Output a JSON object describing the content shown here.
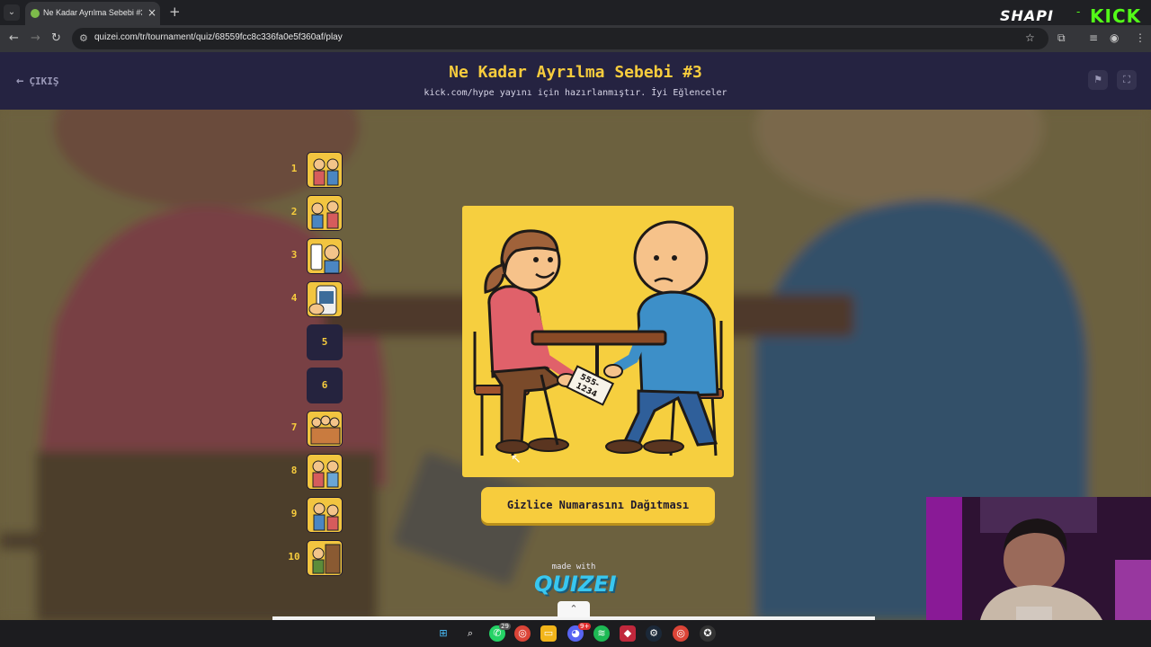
{
  "browser": {
    "tab_title": "Ne Kadar Ayrılma Sebebi #3 - T",
    "url": "quizei.com/tr/tournament/quiz/68559fcc8c336fa0e5f360af/play",
    "brand_left": "SHAPI",
    "brand_right": "KICK"
  },
  "header": {
    "exit_label": "ÇIKIŞ",
    "title": "Ne Kadar Ayrılma Sebebi #3",
    "subtitle": "kick.com/hype yayını için hazırlanmıştır. İyi Eğlenceler"
  },
  "progress": [
    {
      "num": "1",
      "state": "image"
    },
    {
      "num": "2",
      "state": "image"
    },
    {
      "num": "3",
      "state": "image"
    },
    {
      "num": "4",
      "state": "image"
    },
    {
      "num": "5",
      "state": "empty"
    },
    {
      "num": "6",
      "state": "empty"
    },
    {
      "num": "7",
      "state": "image"
    },
    {
      "num": "8",
      "state": "image"
    },
    {
      "num": "9",
      "state": "image"
    },
    {
      "num": "10",
      "state": "image"
    }
  ],
  "card": {
    "note_text_1": "555-",
    "note_text_2": "1234",
    "answer_label": "Gizlice Numarasını Dağıtması"
  },
  "footer": {
    "made_with": "made with",
    "logo": "QUIZEI"
  },
  "taskbar": {
    "whatsapp_badge": "29",
    "discord_badge": "9+"
  },
  "colors": {
    "accent": "#f7cc3d",
    "header_bg": "#252341",
    "quizei_logo": "#38c7f0"
  }
}
